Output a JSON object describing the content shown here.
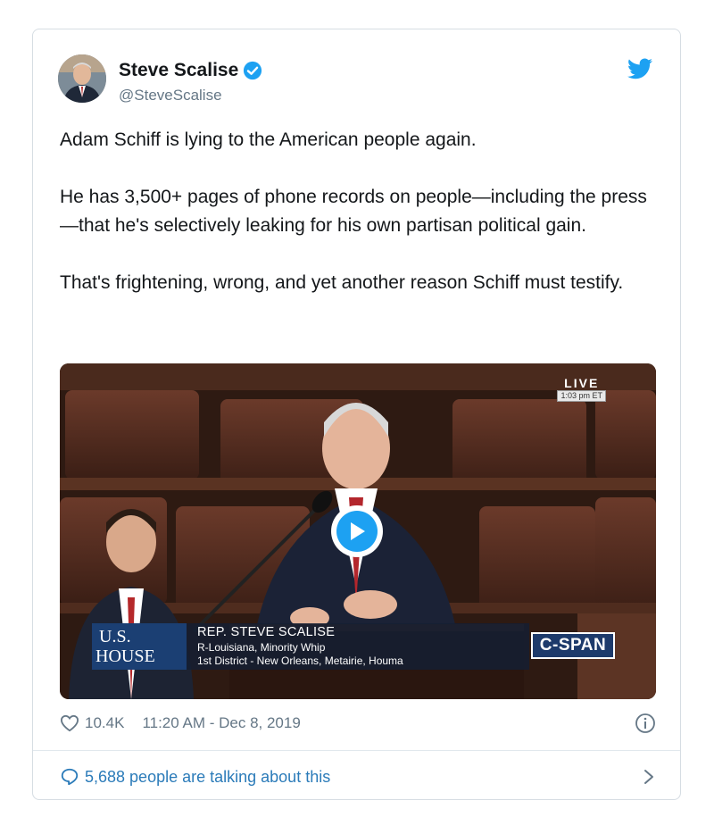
{
  "user": {
    "name": "Steve Scalise",
    "handle": "@SteveScalise"
  },
  "tweet": {
    "paragraphs": [
      "Adam Schiff is lying to the American people again.",
      "He has 3,500+ pages of phone records on people—including the press—that he's selectively leaking for his own partisan political gain.",
      "That's frightening, wrong, and yet another reason Schiff must testify."
    ]
  },
  "video": {
    "live_label": "LIVE",
    "live_time": "1:03 pm ET",
    "logo_line1": "U.S.",
    "logo_line2": "HOUSE",
    "chyron_name": "REP. STEVE SCALISE",
    "chyron_role": "R-Louisiana, Minority Whip",
    "chyron_district": "1st District - New Orleans, Metairie, Houma",
    "network": "C-SPAN"
  },
  "meta": {
    "likes": "10.4K",
    "timestamp": "11:20 AM - Dec 8, 2019"
  },
  "footer": {
    "talking": "5,688 people are talking about this"
  },
  "colors": {
    "accent": "#1da1f2",
    "link": "#2b7bb9",
    "muted": "#657786"
  }
}
